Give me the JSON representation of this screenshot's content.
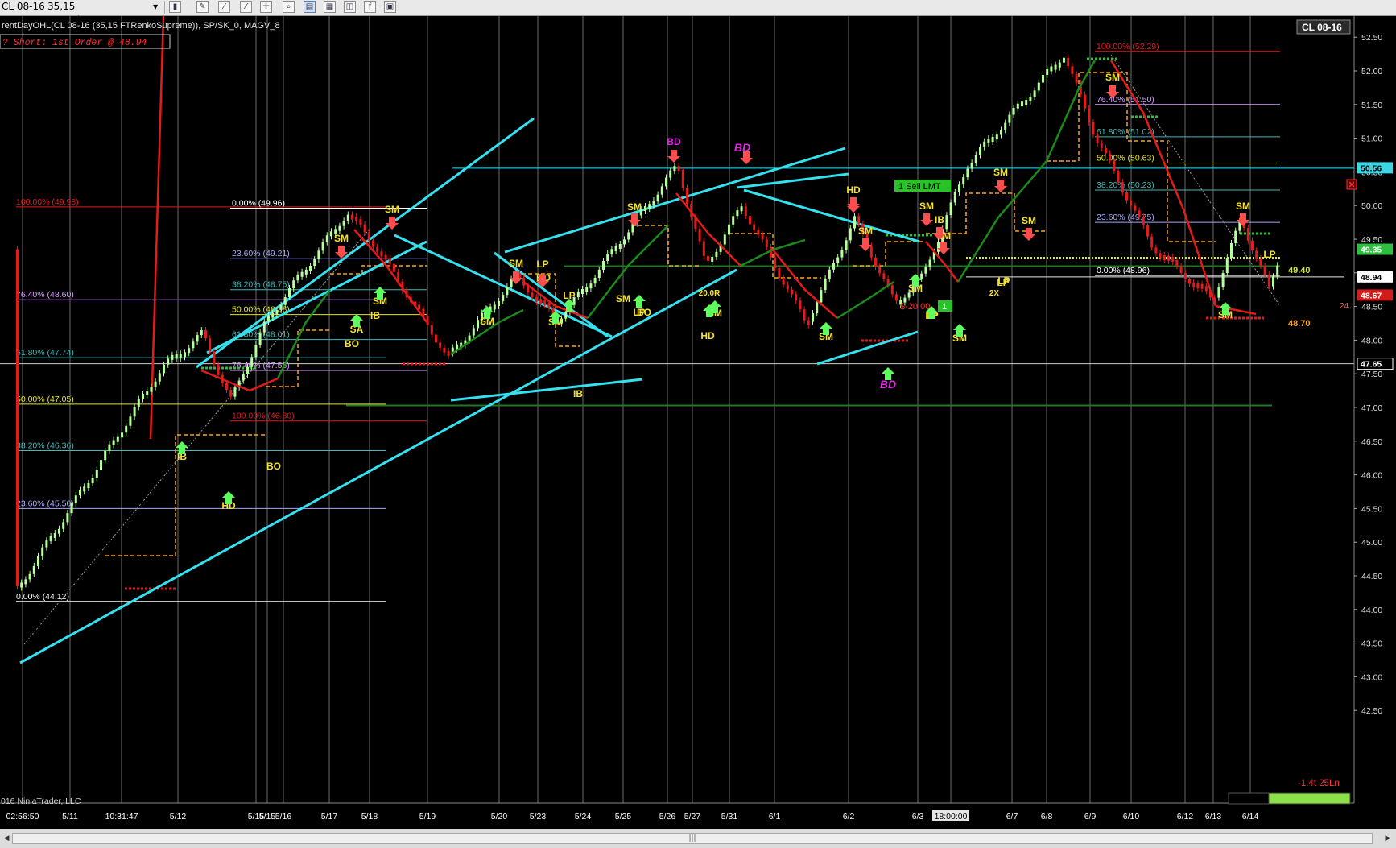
{
  "toolbar": {
    "instrument": "CL 08-16",
    "bar_type": "35,15 FTRenkoSupreme",
    "dropdown_icon": "chevron-down-icon"
  },
  "chart": {
    "indicator_line": "rentDayOHL(CL 08-16 (35,15 FTRenkoSupreme)), SP/SK_0, MAGV_8",
    "order_label": "? Short: 1st Order @ 48.94",
    "instrument_badge": "CL 08-16",
    "copyright": "016 NinjaTrader, LLC",
    "pnl_label": "-1.4t 25Ln",
    "sell_order_label": "1  Sell LMT",
    "sell_order_qty": "1",
    "order_pnl": "$-20.00",
    "order_price_tag": "24"
  },
  "chart_data": {
    "type": "bar",
    "y_axis_ticks": [
      "52.50",
      "52.00",
      "51.50",
      "51.00",
      "50.50",
      "50.00",
      "49.50",
      "49.00",
      "48.50",
      "48.00",
      "47.50",
      "47.00",
      "46.50",
      "46.00",
      "45.50",
      "45.00",
      "44.50",
      "44.00",
      "43.50",
      "43.00",
      "42.50"
    ],
    "price_tags": [
      {
        "value": "50.56",
        "color": "#3fd6e3",
        "text_color": "#000000"
      },
      {
        "value": "49.35",
        "color": "#2fbf3f",
        "text_color": "#ffffff"
      },
      {
        "value": "48.94",
        "color": "#ffffff",
        "text_color": "#000000"
      },
      {
        "value": "48.67",
        "color": "#d21b1b",
        "text_color": "#ffffff"
      },
      {
        "value": "47.65",
        "color": "#000000",
        "text_color": "#ffffff"
      }
    ],
    "x_axis_ticks": [
      "02:56:50",
      "5/11",
      "10:31:47",
      "5/12",
      "5/15",
      "5/15",
      "5/16",
      "5/17",
      "5/18",
      "5/19",
      "5/20",
      "5/23",
      "5/24",
      "5/25",
      "5/26",
      "5/27",
      "5/31",
      "6/1",
      "6/2",
      "6/3",
      "18:00:00",
      "6/7",
      "6/8",
      "6/9",
      "6/10",
      "6/12",
      "6/13",
      "6/14"
    ],
    "fib_sets": [
      {
        "levels": [
          "100.00% (49.98)",
          "76.40% (48.60)",
          "61.80% (47.74)",
          "50.00% (47.05)",
          "38.20% (46.36)",
          "23.60% (45.50)",
          "0.00% (44.12)"
        ]
      },
      {
        "levels": [
          "0.00% (49.96)",
          "23.60% (49.21)",
          "38.20% (48.75)",
          "50.00% (48.38)",
          "61.80% (48.01)",
          "76.40% (47.55)",
          "100.00% (46.80)"
        ]
      },
      {
        "levels": [
          "100.00% (52.29)",
          "76.40% (51.50)",
          "61.80% (51.02)",
          "50.00% (50.63)",
          "38.20% (50.23)",
          "23.60% (49.75)",
          "0.00% (48.96)"
        ]
      }
    ],
    "signals": [
      "SM",
      "IB",
      "HD",
      "BO",
      "LP",
      "BD",
      "SA",
      "2X",
      "20.0R"
    ],
    "right_labels": [
      "49.40",
      "48.70"
    ],
    "palette": {
      "up": "#b6ff9c",
      "down": "#e31b1b",
      "trend_up": "#1b8a1b",
      "trend_down": "#e31b1b",
      "trendline": "#35e0ef",
      "signal": "#f5e22a",
      "bd": "#e028e0"
    }
  }
}
